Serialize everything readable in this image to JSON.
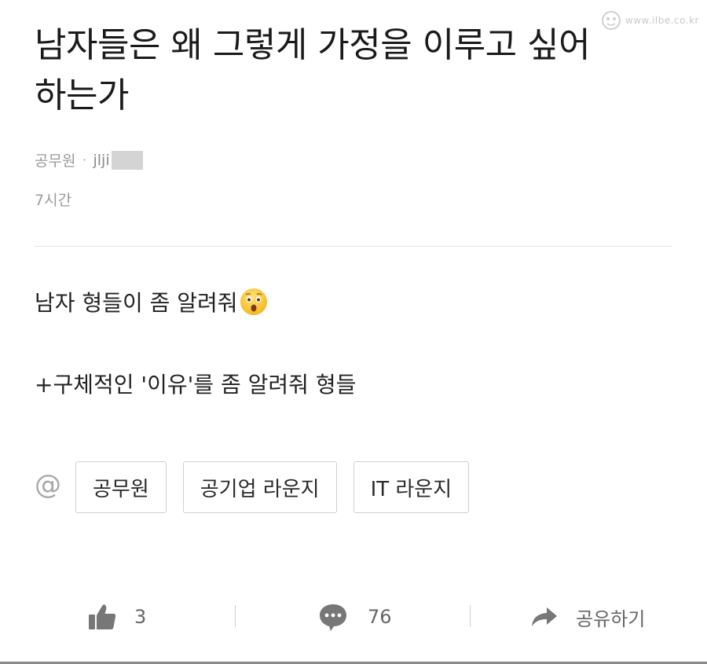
{
  "watermark": {
    "text": "www.ilbe.co.kr",
    "icon": "ilbe-logo-icon"
  },
  "post": {
    "title": "남자들은 왜 그렇게 가정을 이루고 싶어 하는가",
    "category": "공무원",
    "author_visible": "jlji",
    "time": "7시간",
    "body": [
      "남자 형들이 좀 알려줘",
      "+구체적인 '이유'를 좀 알려줘 형들"
    ],
    "body_emoji": "astonished-face-emoji"
  },
  "tags": {
    "at_symbol": "@",
    "items": [
      {
        "label": "공무원"
      },
      {
        "label": "공기업 라운지"
      },
      {
        "label": "IT 라운지"
      }
    ]
  },
  "actions": {
    "like": {
      "icon": "thumbs-up-icon",
      "count": "3"
    },
    "comment": {
      "icon": "comment-bubble-icon",
      "count": "76"
    },
    "share": {
      "icon": "share-arrow-icon",
      "label": "공유하기"
    }
  },
  "colors": {
    "title": "#1a1a1a",
    "meta": "#9a9a9a",
    "divider": "#e6e6e6",
    "tag_border": "#d0d0d0",
    "icon": "#777777"
  }
}
